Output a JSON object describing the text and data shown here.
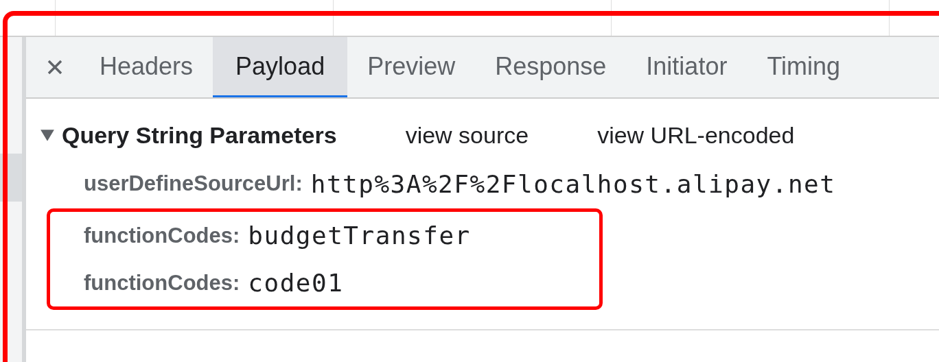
{
  "tabs": [
    {
      "label": "Headers",
      "selected": false
    },
    {
      "label": "Payload",
      "selected": true
    },
    {
      "label": "Preview",
      "selected": false
    },
    {
      "label": "Response",
      "selected": false
    },
    {
      "label": "Initiator",
      "selected": false
    },
    {
      "label": "Timing",
      "selected": false
    }
  ],
  "section": {
    "title": "Query String Parameters",
    "expanded": true,
    "links": [
      "view source",
      "view URL-encoded"
    ]
  },
  "params": [
    {
      "key": "userDefineSourceUrl:",
      "value": "http%3A%2F%2Flocalhost.alipay.net",
      "annotated": false
    },
    {
      "key": "functionCodes:",
      "value": "budgetTransfer",
      "annotated": true
    },
    {
      "key": "functionCodes:",
      "value": "code01",
      "annotated": true
    }
  ]
}
